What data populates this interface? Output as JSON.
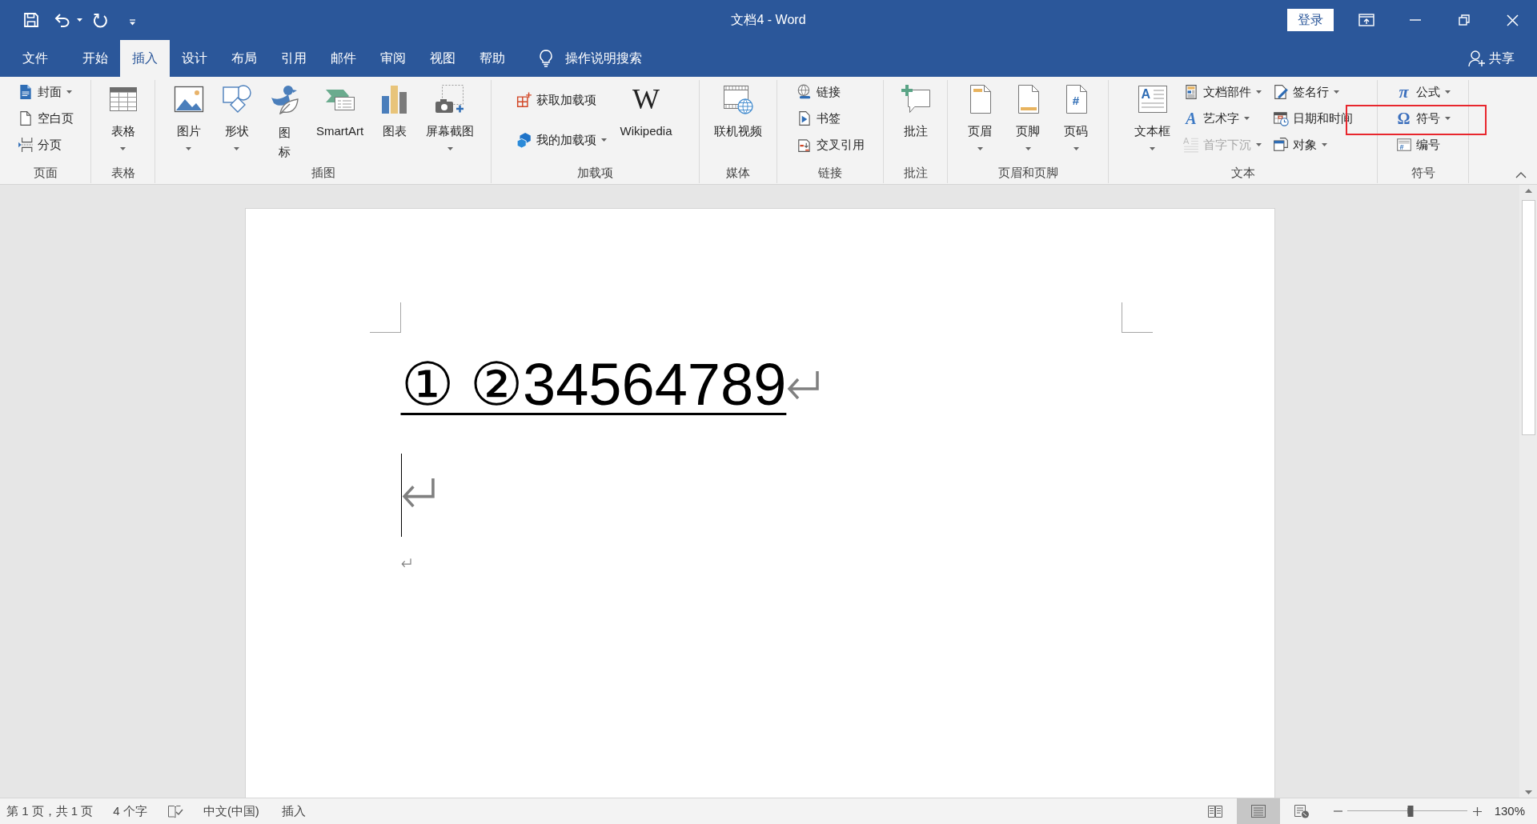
{
  "window": {
    "title": "文档4 - Word",
    "sign_in": "登录"
  },
  "tabs": [
    {
      "label": "文件",
      "selected": false
    },
    {
      "label": "开始",
      "selected": false
    },
    {
      "label": "插入",
      "selected": true
    },
    {
      "label": "设计",
      "selected": false
    },
    {
      "label": "布局",
      "selected": false
    },
    {
      "label": "引用",
      "selected": false
    },
    {
      "label": "邮件",
      "selected": false
    },
    {
      "label": "审阅",
      "selected": false
    },
    {
      "label": "视图",
      "selected": false
    },
    {
      "label": "帮助",
      "selected": false
    }
  ],
  "tell_me": {
    "label": "操作说明搜索"
  },
  "share": {
    "label": "共享"
  },
  "ribbon": {
    "groups": [
      {
        "label": "页面",
        "highlighted": false,
        "items": [
          {
            "kind": "small",
            "label": "封面",
            "dropdown": true,
            "disabled": false
          },
          {
            "kind": "small",
            "label": "空白页",
            "dropdown": false,
            "disabled": false
          },
          {
            "kind": "small",
            "label": "分页",
            "dropdown": false,
            "disabled": false
          }
        ]
      },
      {
        "label": "表格",
        "highlighted": false,
        "items": [
          {
            "kind": "large",
            "label": "表格",
            "dropdown": true,
            "disabled": false
          }
        ]
      },
      {
        "label": "插图",
        "highlighted": false,
        "items": [
          {
            "kind": "large",
            "label": "图片",
            "dropdown": true,
            "disabled": false
          },
          {
            "kind": "large",
            "label": "形状",
            "dropdown": true,
            "disabled": false
          },
          {
            "kind": "tall",
            "label": "图标",
            "dropdown": false,
            "disabled": false
          },
          {
            "kind": "large",
            "label": "SmartArt",
            "dropdown": false,
            "disabled": false
          },
          {
            "kind": "large",
            "label": "图表",
            "dropdown": false,
            "disabled": false
          },
          {
            "kind": "large",
            "label": "屏幕截图",
            "dropdown": true,
            "disabled": false
          }
        ]
      },
      {
        "label": "加载项",
        "highlighted": false,
        "items": [
          {
            "kind": "small",
            "label": "获取加载项",
            "dropdown": false,
            "disabled": false
          },
          {
            "kind": "small",
            "label": "我的加载项",
            "dropdown": true,
            "disabled": false
          },
          {
            "kind": "large",
            "label": "Wikipedia",
            "dropdown": false,
            "disabled": false,
            "glyph": "W"
          }
        ]
      },
      {
        "label": "媒体",
        "highlighted": false,
        "items": [
          {
            "kind": "large",
            "label": "联机视频",
            "dropdown": false,
            "disabled": false
          }
        ]
      },
      {
        "label": "链接",
        "highlighted": false,
        "items": [
          {
            "kind": "small",
            "label": "链接",
            "dropdown": false,
            "disabled": false
          },
          {
            "kind": "small",
            "label": "书签",
            "dropdown": false,
            "disabled": false
          },
          {
            "kind": "small",
            "label": "交叉引用",
            "dropdown": false,
            "disabled": false
          }
        ]
      },
      {
        "label": "批注",
        "highlighted": false,
        "items": [
          {
            "kind": "large",
            "label": "批注",
            "dropdown": false,
            "disabled": false
          }
        ]
      },
      {
        "label": "页眉和页脚",
        "highlighted": false,
        "items": [
          {
            "kind": "large",
            "label": "页眉",
            "dropdown": true,
            "disabled": false
          },
          {
            "kind": "large",
            "label": "页脚",
            "dropdown": true,
            "disabled": false
          },
          {
            "kind": "large",
            "label": "页码",
            "dropdown": true,
            "disabled": false,
            "glyph": "#"
          }
        ]
      },
      {
        "label": "文本",
        "highlighted": false,
        "items": [
          {
            "kind": "large",
            "label": "文本框",
            "dropdown": true,
            "disabled": false,
            "glyph": "A"
          },
          {
            "kind": "small",
            "label": "文档部件",
            "dropdown": true,
            "disabled": false
          },
          {
            "kind": "small",
            "label": "艺术字",
            "dropdown": true,
            "disabled": false,
            "glyph": "A"
          },
          {
            "kind": "small",
            "label": "首字下沉",
            "dropdown": true,
            "disabled": true,
            "glyph": "A"
          },
          {
            "kind": "small",
            "label": "签名行",
            "dropdown": true,
            "disabled": false
          },
          {
            "kind": "small",
            "label": "日期和时间",
            "dropdown": false,
            "disabled": false
          },
          {
            "kind": "small",
            "label": "对象",
            "dropdown": true,
            "disabled": false
          }
        ]
      },
      {
        "label": "符号",
        "highlighted": true,
        "items": [
          {
            "kind": "small",
            "label": "公式",
            "dropdown": true,
            "disabled": false,
            "glyph": "π"
          },
          {
            "kind": "small",
            "label": "符号",
            "dropdown": true,
            "disabled": false,
            "glyph": "Ω"
          },
          {
            "kind": "small",
            "label": "编号",
            "dropdown": false,
            "disabled": false,
            "glyph": "#"
          }
        ]
      }
    ]
  },
  "document": {
    "paragraphs": [
      {
        "kind": "text",
        "text": "① ②34564789",
        "underline": true,
        "cursor": false
      },
      {
        "kind": "blank",
        "cursor": true
      },
      {
        "kind": "blank_small",
        "cursor": false
      }
    ]
  },
  "status_bar": {
    "page": "第 1 页，共 1 页",
    "words": "4 个字",
    "language": "中文(中国)",
    "mode": "插入",
    "views": [
      {
        "selected": false
      },
      {
        "selected": true
      },
      {
        "selected": false
      }
    ],
    "zoom": {
      "level": 0.53,
      "reading": "130%"
    }
  }
}
